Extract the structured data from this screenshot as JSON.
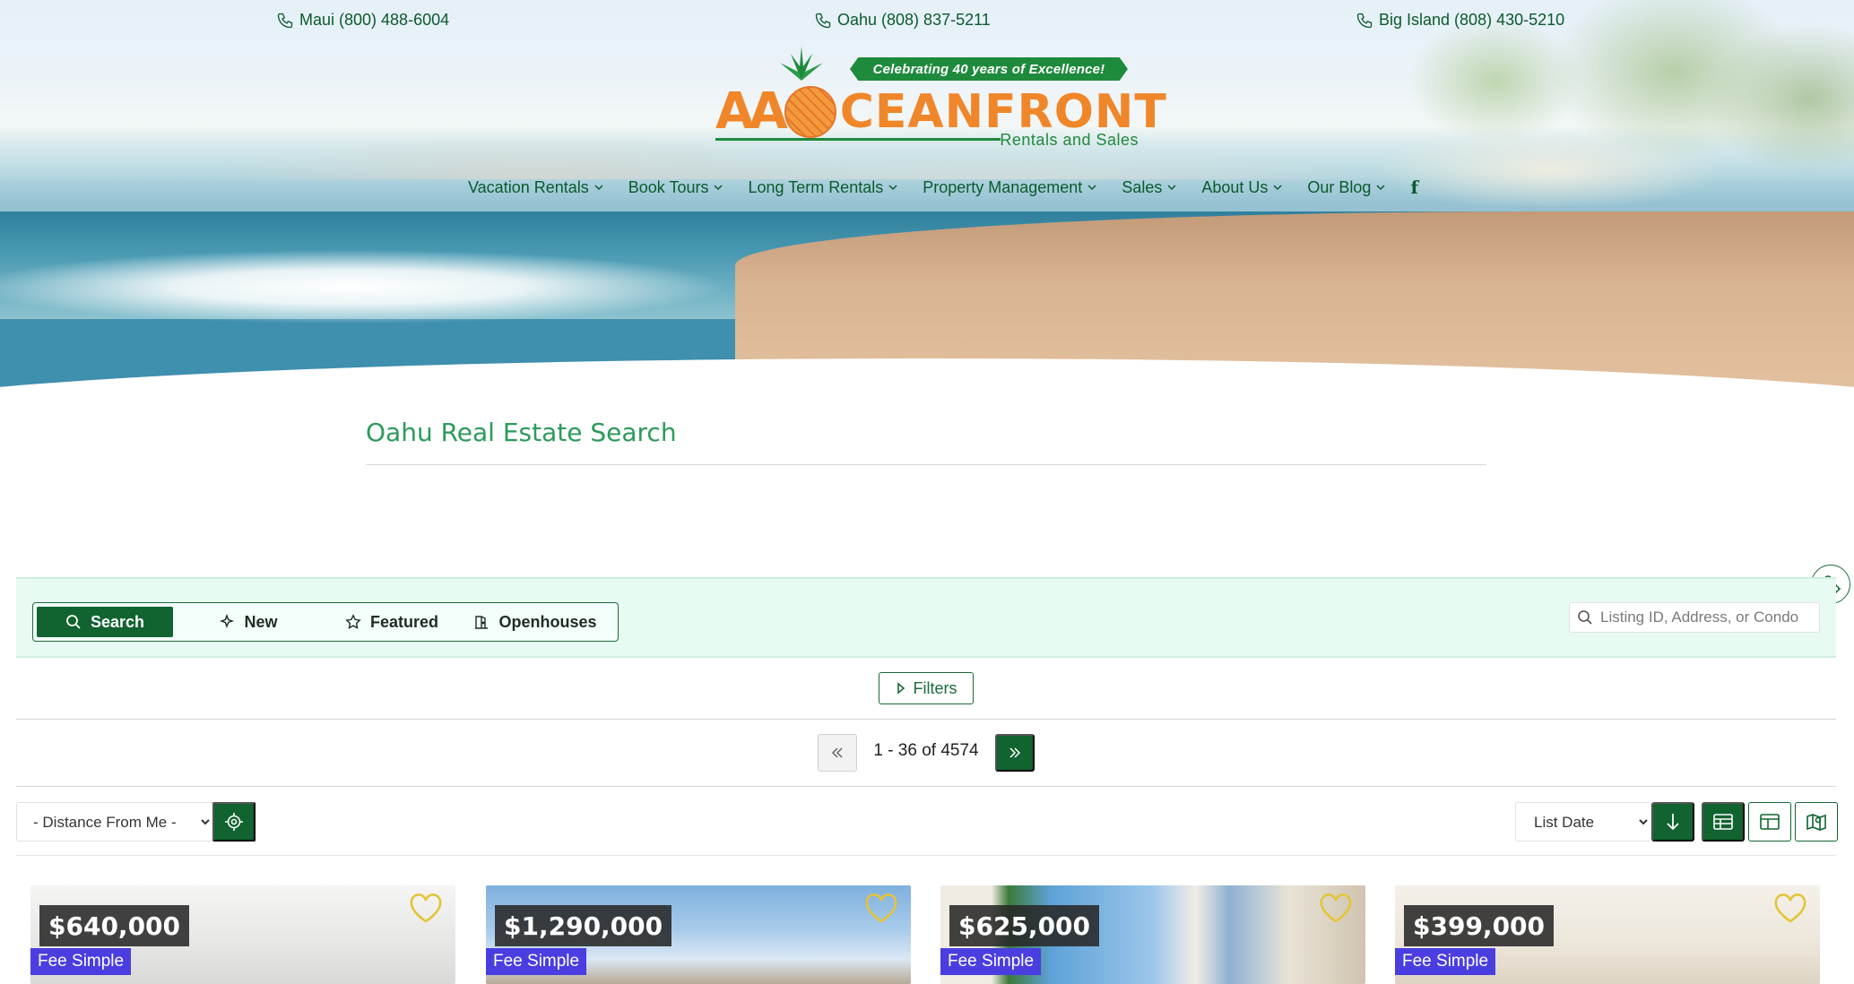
{
  "header": {
    "phones": [
      {
        "label": "Maui (800) 488-6004"
      },
      {
        "label": "Oahu (808) 837-5211"
      },
      {
        "label": "Big Island (808) 430-5210"
      }
    ],
    "logo": {
      "banner": "Celebrating 40 years of Excellence!",
      "word_aa": "AA",
      "word_rest": "CEANFRONT",
      "sub": "Rentals and Sales"
    },
    "nav": [
      {
        "label": "Vacation Rentals"
      },
      {
        "label": "Book Tours"
      },
      {
        "label": "Long Term Rentals"
      },
      {
        "label": "Property Management"
      },
      {
        "label": "Sales"
      },
      {
        "label": "About Us"
      },
      {
        "label": "Our Blog"
      }
    ],
    "facebook_icon": "f"
  },
  "page": {
    "title": "Oahu Real Estate Search"
  },
  "search_panel": {
    "tabs": [
      {
        "label": "Search",
        "icon": "search-icon",
        "active": true
      },
      {
        "label": "New",
        "icon": "sparkle-icon",
        "active": false
      },
      {
        "label": "Featured",
        "icon": "star-icon",
        "active": false
      },
      {
        "label": "Openhouses",
        "icon": "door-icon",
        "active": false
      }
    ],
    "search_placeholder": "Listing ID, Address, or Condo"
  },
  "filters": {
    "label": "Filters"
  },
  "pagination": {
    "range_text": "1 - 36 of 4574"
  },
  "toolbar": {
    "distance_select": {
      "selected": "- Distance From Me -"
    },
    "sort_select": {
      "selected": "List Date"
    }
  },
  "listings": [
    {
      "price": "$640,000",
      "tenure": "Fee Simple"
    },
    {
      "price": "$1,290,000",
      "tenure": "Fee Simple"
    },
    {
      "price": "$625,000",
      "tenure": "Fee Simple"
    },
    {
      "price": "$399,000",
      "tenure": "Fee Simple"
    }
  ],
  "colors": {
    "brand_green": "#11632f",
    "text_green": "#0b5a2c",
    "title_green": "#2b9a5a",
    "logo_orange": "#f0862a",
    "panel_bg": "#e8fbf3",
    "tenure_badge": "#4a3ee0"
  }
}
